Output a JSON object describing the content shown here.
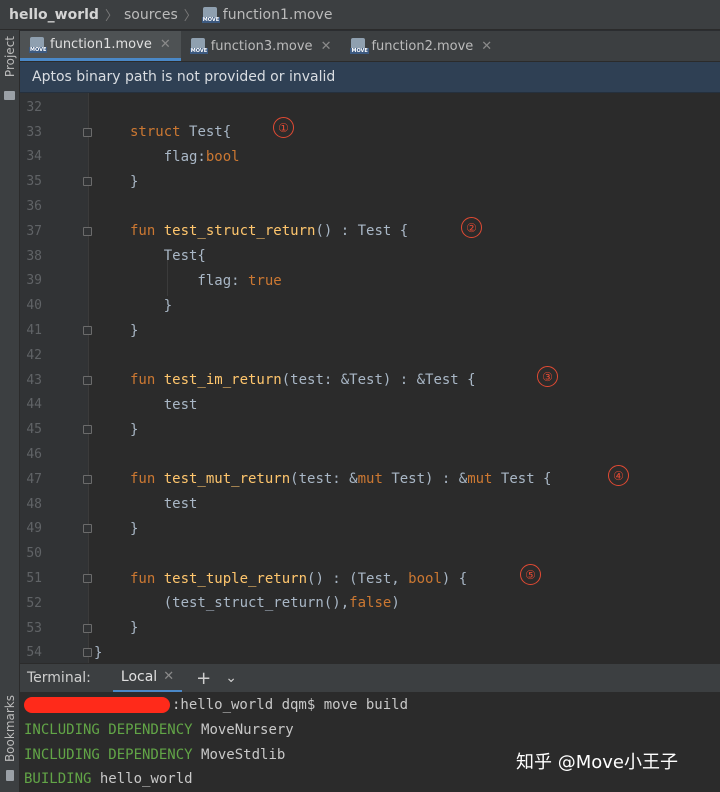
{
  "breadcrumb": {
    "project": "hello_world",
    "folder": "sources",
    "file": "function1.move",
    "file_icon": "move-file-icon"
  },
  "left_strip": {
    "project_label": "Project",
    "bookmarks_label": "Bookmarks"
  },
  "tabs": [
    {
      "label": "function1.move",
      "active": true
    },
    {
      "label": "function3.move",
      "active": false
    },
    {
      "label": "function2.move",
      "active": false
    }
  ],
  "banner": {
    "text": "Aptos binary path is not provided or invalid"
  },
  "editor": {
    "lines": [
      {
        "num": "32"
      },
      {
        "num": "33",
        "segments": [
          [
            "kw",
            "struct "
          ],
          [
            "plain",
            "Test{"
          ]
        ]
      },
      {
        "num": "34",
        "segments": [
          [
            "plain",
            "    flag:"
          ],
          [
            "kw",
            "bool"
          ]
        ]
      },
      {
        "num": "35",
        "segments": [
          [
            "plain",
            "}"
          ]
        ]
      },
      {
        "num": "36"
      },
      {
        "num": "37",
        "segments": [
          [
            "kw",
            "fun "
          ],
          [
            "fn",
            "test_struct_return"
          ],
          [
            "plain",
            "() : Test {"
          ]
        ]
      },
      {
        "num": "38",
        "segments": [
          [
            "plain",
            "    Test{"
          ]
        ]
      },
      {
        "num": "39",
        "segments": [
          [
            "plain",
            "        flag: "
          ],
          [
            "kw",
            "true"
          ]
        ]
      },
      {
        "num": "40",
        "segments": [
          [
            "plain",
            "    }"
          ]
        ]
      },
      {
        "num": "41",
        "segments": [
          [
            "plain",
            "}"
          ]
        ]
      },
      {
        "num": "42"
      },
      {
        "num": "43",
        "segments": [
          [
            "kw",
            "fun "
          ],
          [
            "fn",
            "test_im_return"
          ],
          [
            "plain",
            "(test: &Test) : &Test {"
          ]
        ]
      },
      {
        "num": "44",
        "segments": [
          [
            "plain",
            "    test"
          ]
        ]
      },
      {
        "num": "45",
        "segments": [
          [
            "plain",
            "}"
          ]
        ]
      },
      {
        "num": "46"
      },
      {
        "num": "47",
        "segments": [
          [
            "kw",
            "fun "
          ],
          [
            "fn",
            "test_mut_return"
          ],
          [
            "plain",
            "(test: &"
          ],
          [
            "kw",
            "mut"
          ],
          [
            "plain",
            " Test) : &"
          ],
          [
            "kw",
            "mut"
          ],
          [
            "plain",
            " Test {"
          ]
        ]
      },
      {
        "num": "48",
        "segments": [
          [
            "plain",
            "    test"
          ]
        ]
      },
      {
        "num": "49",
        "segments": [
          [
            "plain",
            "}"
          ]
        ]
      },
      {
        "num": "50"
      },
      {
        "num": "51",
        "segments": [
          [
            "kw",
            "fun "
          ],
          [
            "fn",
            "test_tuple_return"
          ],
          [
            "plain",
            "() : (Test, "
          ],
          [
            "kw",
            "bool"
          ],
          [
            "plain",
            ") {"
          ]
        ]
      },
      {
        "num": "52",
        "segments": [
          [
            "plain",
            "    (test_struct_return(),"
          ],
          [
            "kw",
            "false"
          ],
          [
            "plain",
            ")"
          ]
        ]
      },
      {
        "num": "53",
        "segments": [
          [
            "plain",
            "}"
          ]
        ]
      },
      {
        "num": "54",
        "segments": [
          [
            "plain",
            "}"
          ]
        ]
      }
    ],
    "markers": [
      "①",
      "②",
      "③",
      "④",
      "⑤"
    ]
  },
  "terminal": {
    "title": "Terminal:",
    "tab_label": "Local",
    "add_icon": "plus-icon",
    "menu_icon": "chevron-down-icon",
    "lines": [
      {
        "prompt_suffix": ":hello_world dqm$ move build"
      },
      {
        "label": "INCLUDING DEPENDENCY",
        "value": "MoveNursery"
      },
      {
        "label": "INCLUDING DEPENDENCY",
        "value": "MoveStdlib"
      },
      {
        "label": "BUILDING",
        "value": "hello_world"
      }
    ]
  },
  "watermark": "知乎 @Move小王子",
  "colors": {
    "keyword": "#cc7832",
    "function": "#ffc66d",
    "accent": "#4a88c7",
    "marker": "#e24a33",
    "terminal_green": "#62a547"
  }
}
